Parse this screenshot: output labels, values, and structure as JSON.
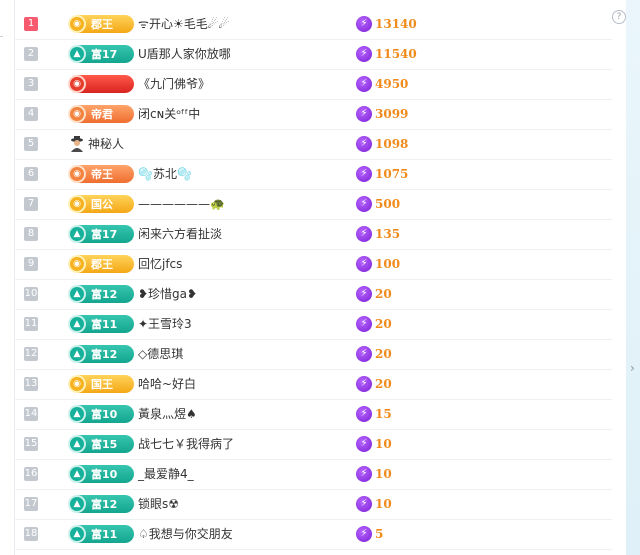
{
  "icons": {
    "help": "?",
    "scroll_right": "›",
    "bolt": "⚡"
  },
  "colors": {
    "rank_first": "#f7596f",
    "rank_default": "#c3c8cf",
    "score": "#f08a1a",
    "bolt": "#8b2be2"
  },
  "rows": [
    {
      "rank": "1",
      "badge_text": "郡王",
      "badge_type": "gold",
      "name": "ᯤ开心☀毛毛☄☄",
      "score": "13140"
    },
    {
      "rank": "2",
      "badge_text": "富17",
      "badge_type": "teal",
      "name": "U盾那人家你放哪",
      "score": "11540"
    },
    {
      "rank": "3",
      "badge_text": "",
      "badge_type": "red",
      "name": "《九门佛爷》",
      "score": "4950"
    },
    {
      "rank": "4",
      "badge_text": "帝君",
      "badge_type": "orange",
      "name": "闭ᴄɴ关ᵒᶠᶠ中",
      "score": "3099"
    },
    {
      "rank": "5",
      "badge_text": "",
      "badge_type": "none",
      "name": "神秘人",
      "score": "1098"
    },
    {
      "rank": "6",
      "badge_text": "帝王",
      "badge_type": "orange",
      "name": "🫧苏北🫧",
      "score": "1075"
    },
    {
      "rank": "7",
      "badge_text": "国公",
      "badge_type": "gold",
      "name": "——————🐢",
      "score": "500"
    },
    {
      "rank": "8",
      "badge_text": "富17",
      "badge_type": "teal",
      "name": "闲来六方看扯淡",
      "score": "135"
    },
    {
      "rank": "9",
      "badge_text": "郡王",
      "badge_type": "gold",
      "name": "回忆jfcs",
      "score": "100"
    },
    {
      "rank": "10",
      "badge_text": "富12",
      "badge_type": "teal",
      "name": "❥珍惜ga❥",
      "score": "20"
    },
    {
      "rank": "11",
      "badge_text": "富11",
      "badge_type": "teal",
      "name": "✦王雪玲3",
      "score": "20"
    },
    {
      "rank": "12",
      "badge_text": "富12",
      "badge_type": "teal",
      "name": "◇德思琪",
      "score": "20"
    },
    {
      "rank": "13",
      "badge_text": "国王",
      "badge_type": "gold",
      "name": "哈哈~好白",
      "score": "20"
    },
    {
      "rank": "14",
      "badge_text": "富10",
      "badge_type": "teal",
      "name": "黃泉灬煜♠",
      "score": "15"
    },
    {
      "rank": "15",
      "badge_text": "富15",
      "badge_type": "teal",
      "name": "战七七￥我得病了",
      "score": "10"
    },
    {
      "rank": "16",
      "badge_text": "富10",
      "badge_type": "teal",
      "name": "_最爱静4_",
      "score": "10"
    },
    {
      "rank": "17",
      "badge_text": "富12",
      "badge_type": "teal",
      "name": "锁眼s☢",
      "score": "10"
    },
    {
      "rank": "18",
      "badge_text": "富11",
      "badge_type": "teal",
      "name": "♤我想与你交朋友",
      "score": "5"
    }
  ]
}
